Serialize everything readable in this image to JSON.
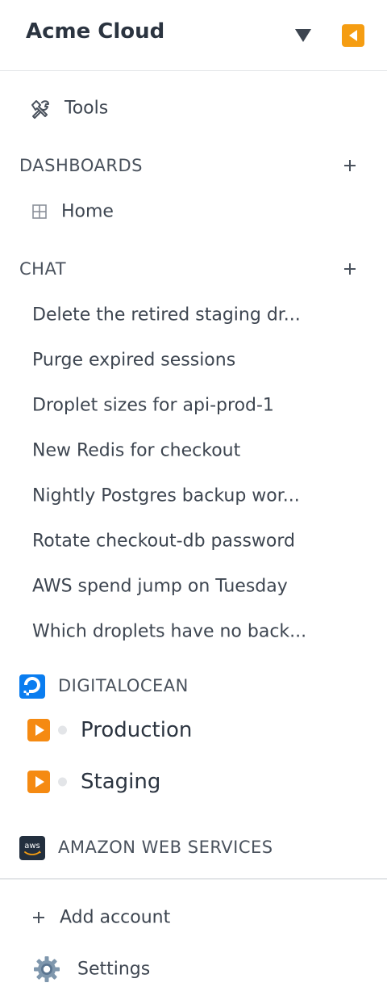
{
  "header": {
    "org_name": "Acme Cloud",
    "dropdown_icon": "caret-down-icon",
    "collapse_icon": "collapse-left-icon",
    "collapse_color": "#f59d12"
  },
  "tools": {
    "label": "Tools",
    "icon": "tools-icon"
  },
  "dashboards": {
    "section_title": "DASHBOARDS",
    "add_icon": "plus-icon",
    "items": [
      {
        "label": "Home",
        "icon": "grid-icon"
      }
    ]
  },
  "chat": {
    "section_title": "CHAT",
    "add_icon": "plus-icon",
    "items": [
      {
        "label": "Delete the retired staging dr..."
      },
      {
        "label": "Purge expired sessions"
      },
      {
        "label": "Droplet sizes for api-prod-1"
      },
      {
        "label": "New Redis for checkout"
      },
      {
        "label": "Nightly Postgres backup wor..."
      },
      {
        "label": "Rotate checkout-db password"
      },
      {
        "label": "AWS spend jump on Tuesday"
      },
      {
        "label": "Which droplets have no back..."
      }
    ]
  },
  "providers": [
    {
      "name": "DIGITALOCEAN",
      "logo": "digitalocean-logo",
      "logo_color": "#0a7df0",
      "environments": [
        {
          "label": "Production",
          "icon": "play-icon"
        },
        {
          "label": "Staging",
          "icon": "play-icon"
        }
      ]
    },
    {
      "name": "AMAZON WEB SERVICES",
      "logo": "aws-logo",
      "logo_color": "#232f3e",
      "logo_text": "aws",
      "environments": []
    }
  ],
  "footer": {
    "add_account_label": "Add account",
    "add_account_icon": "plus-icon",
    "settings_label": "Settings",
    "settings_icon": "gear-icon"
  },
  "colors": {
    "accent_orange": "#f58a12",
    "divider": "#e3e5e8",
    "text_primary": "#2b3440",
    "text_secondary": "#3d4550"
  }
}
